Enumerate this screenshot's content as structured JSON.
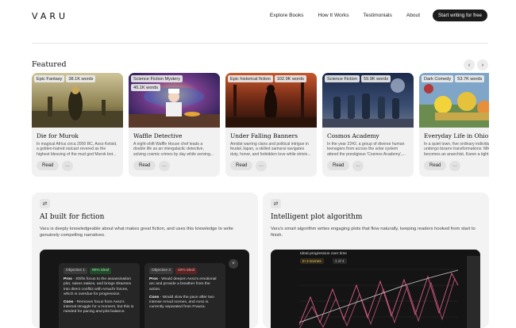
{
  "brand": {
    "logo": "VARU"
  },
  "nav": {
    "links": [
      "Explore Books",
      "How It Works",
      "Testimonials",
      "About"
    ],
    "cta": "Start writing for free"
  },
  "featured": {
    "title": "Featured",
    "prev_icon": "chevron-left-icon",
    "next_icon": "chevron-right-icon",
    "cards": [
      {
        "tags": [
          "Epic Fantasy",
          "38.1K words"
        ],
        "title": "Die for Murok",
        "desc": "In magical Africa circa 2000 BC, Avso Ketsid, a golden-haired outcast revered as the highest blessing of the mud god Murok bot...",
        "read": "Read",
        "more": "···"
      },
      {
        "tags": [
          "Science Fiction Mystery",
          "40.1K words"
        ],
        "title": "Waffle Detective",
        "desc": "A night-shift Waffle House chef leads a double life as an intergalactic detective, solving cosmic crimes by day while serving...",
        "read": "Read",
        "more": "···"
      },
      {
        "tags": [
          "Epic historical fiction",
          "102.9K words"
        ],
        "title": "Under Falling Banners",
        "desc": "Amidst warring clans and political intrigue in feudal Japan, a skilled samurai navigates duty, honor, and forbidden love while strivin...",
        "read": "Read",
        "more": "···"
      },
      {
        "tags": [
          "Science Fiction",
          "59.9K words"
        ],
        "title": "Cosmos Academy",
        "desc": "In the year 2242, a group of diverse human teenagers from across the solar system attend the prestigious 'Cosmos Academy',...",
        "read": "Read",
        "more": "···"
      },
      {
        "tags": [
          "Dark Comedy",
          "53.7K words"
        ],
        "title": "Everyday Life in Ohio",
        "desc": "In a quiet town, five ordinary individuals undergo bizarre transformations: Mike becomes an anarchist, Karen a tight...",
        "read": "Read",
        "more": "···"
      }
    ]
  },
  "features": {
    "left": {
      "icon": "swap-icon",
      "title": "AI built for fiction",
      "text": "Varu is deeply knowledgeable about what makes great fiction, and uses this knowledge to write genuinely compelling narratives.",
      "objectives": [
        {
          "label": "Objective 1",
          "score": "90% ideal",
          "pros_label": "Pros",
          "pros": " - Shifts focus to the assassination plot, raises stakes, and brings Skamtos into direct conflict with Arnud's forces, which is overdue for progression.",
          "cons_label": "Cons",
          "cons": " - Removes focus from Avso's internal struggle for a moment, but this is needed for pacing and plot balance."
        },
        {
          "label": "Objective 2",
          "score": "40% ideal",
          "pros_label": "Pros",
          "pros": " - Would deepen Avso's emotional arc and provide a breather from the action.",
          "cons_label": "Cons",
          "cons": " - Would slow the pace after two intense Arnud scenes, and Avso is currently separated from Frauza."
        }
      ],
      "close": "×"
    },
    "right": {
      "icon": "swap-icon",
      "title": "Intelligent plot algorithm",
      "text": "Varu's smart algorithm writes engaging plots that flow naturally, keeping readers hooked from start to finish.",
      "chart_title": "Ideal progression over time",
      "chart_pill1": "In 2 scenes",
      "chart_pill2": "1 of 4"
    }
  }
}
